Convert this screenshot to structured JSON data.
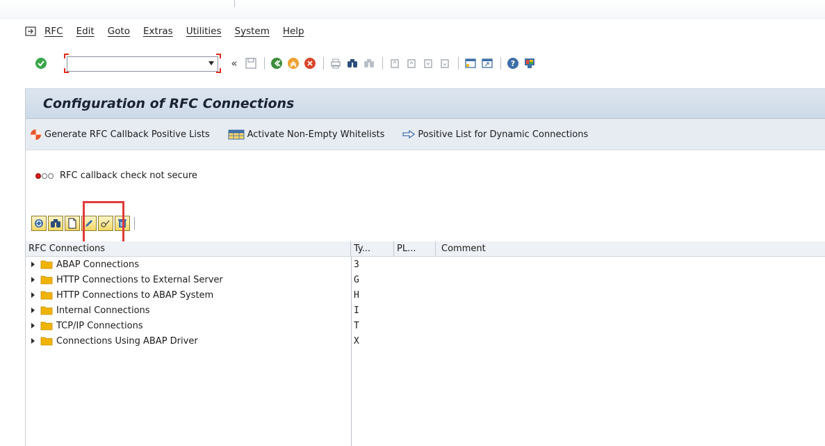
{
  "menu": {
    "items": [
      "RFC",
      "Edit",
      "Goto",
      "Extras",
      "Utilities",
      "System",
      "Help"
    ]
  },
  "toolbar": {
    "command_value": "",
    "icons": [
      "enter-icon",
      "back-icon",
      "exit-icon",
      "cancel-icon",
      "print-icon",
      "find-icon",
      "find-next-icon",
      "first-page-icon",
      "previous-page-icon",
      "next-page-icon",
      "last-page-icon",
      "new-session-icon",
      "shortcut-icon",
      "help-icon",
      "customize-layout-icon"
    ]
  },
  "title": "Configuration of RFC Connections",
  "app_toolbar": {
    "generate": "Generate RFC Callback Positive Lists",
    "activate": "Activate Non-Empty Whitelists",
    "positive": "Positive List for Dynamic Connections"
  },
  "status": {
    "text": "RFC callback check not secure",
    "lights": [
      "red",
      "off",
      "off"
    ]
  },
  "tree": {
    "headers": {
      "name": "RFC Connections",
      "type": "Ty...",
      "pl": "PL...",
      "comment": "Comment"
    },
    "rows": [
      {
        "name": "ABAP Connections",
        "type": "3"
      },
      {
        "name": "HTTP Connections to External Server",
        "type": "G"
      },
      {
        "name": "HTTP Connections to ABAP System",
        "type": "H"
      },
      {
        "name": "Internal Connections",
        "type": "I"
      },
      {
        "name": "TCP/IP Connections",
        "type": "T"
      },
      {
        "name": "Connections Using ABAP Driver",
        "type": "X"
      }
    ]
  },
  "colors": {
    "accent_red": "#e03a3a",
    "title_bar": "#d3dfeb",
    "folder": "#f0b400"
  }
}
